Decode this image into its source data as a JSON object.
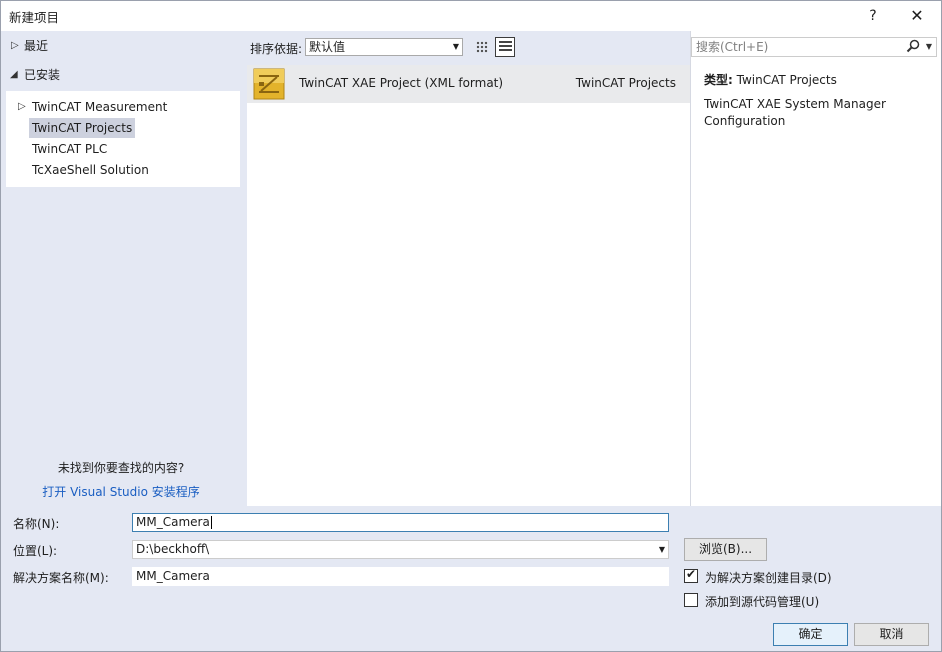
{
  "window": {
    "title": "新建项目",
    "help": "?",
    "close": "✕"
  },
  "tree": {
    "recent": "最近",
    "installed": "已安装",
    "items": [
      {
        "label": "TwinCAT Measurement",
        "expandable": true,
        "selected": false
      },
      {
        "label": "TwinCAT Projects",
        "expandable": false,
        "selected": true
      },
      {
        "label": "TwinCAT PLC",
        "expandable": false,
        "selected": false
      },
      {
        "label": "TcXaeShell Solution",
        "expandable": false,
        "selected": false
      }
    ],
    "not_found": "未找到你要查找的内容?",
    "installer_link": "打开 Visual Studio 安装程序"
  },
  "sort": {
    "label": "排序依据:",
    "value": "默认值"
  },
  "templates": [
    {
      "name": "TwinCAT XAE Project (XML format)",
      "category": "TwinCAT Projects",
      "icon": "twincat-project-icon"
    }
  ],
  "search": {
    "placeholder": "搜索(Ctrl+E)"
  },
  "description": {
    "type_label": "类型:",
    "type_value": "TwinCAT Projects",
    "text": "TwinCAT XAE System Manager Configuration"
  },
  "form": {
    "name_label": "名称(N):",
    "name_value": "MM_Camera",
    "location_label": "位置(L):",
    "location_value": "D:\\beckhoff\\",
    "solution_label": "解决方案名称(M):",
    "solution_value": "MM_Camera",
    "browse": "浏览(B)...",
    "create_dir_label": "为解决方案创建目录(D)",
    "create_dir_checked": true,
    "source_control_label": "添加到源代码管理(U)",
    "source_control_checked": false,
    "ok": "确定",
    "cancel": "取消"
  },
  "colors": {
    "panel_bg": "#e4e8f3",
    "link": "#1a5ec2",
    "selected_bg": "#cdd1de",
    "focus_border": "#3c7fb1",
    "icon_gold": "#e3b32b"
  }
}
